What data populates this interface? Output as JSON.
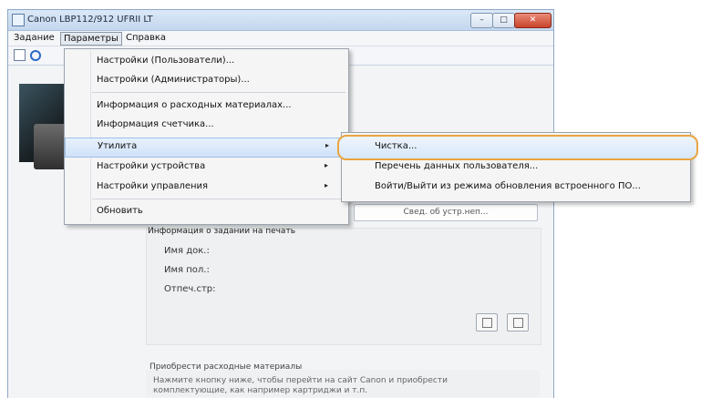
{
  "window": {
    "title": "Canon LBP112/912 UFRII LT",
    "minimize_glyph": "–",
    "maximize_glyph": "□",
    "close_glyph": "✕"
  },
  "menubar": {
    "task": "Задание",
    "params": "Параметры",
    "help": "Справка"
  },
  "dropdown": {
    "items": [
      {
        "label": "Настройки (Пользователи)..."
      },
      {
        "label": "Настройки (Администраторы)..."
      },
      {
        "label": "Информация о расходных материалах..."
      },
      {
        "label": "Информация счетчика..."
      },
      {
        "label": "Утилита",
        "arrow": "▸"
      },
      {
        "label": "Настройки устройства",
        "arrow": "▸"
      },
      {
        "label": "Настройки управления",
        "arrow": "▸"
      },
      {
        "label": "Обновить"
      }
    ]
  },
  "submenu": {
    "items": [
      {
        "label": "Чистка..."
      },
      {
        "label": "Перечень данных пользователя..."
      },
      {
        "label": "Войти/Выйти из режима обновления встроенного ПО..."
      }
    ]
  },
  "panel": {
    "device_info_button": "Свед. об устр.неп...",
    "job_info_title": "Информация о задании на печать",
    "doc_name": "Имя док.:",
    "user_name": "Имя пол.:",
    "printed_pages": "Отпеч.стр:"
  },
  "buy": {
    "title": "Приобрести расходные материалы",
    "text": "Нажмите кнопку ниже, чтобы перейти на сайт Canon и приобрести комплектующие, как например картриджи и т.п."
  },
  "icons": {
    "app": "app-icon",
    "list": "list-icon",
    "refresh": "refresh-icon"
  },
  "colors": {
    "highlight_border": "#e9a441",
    "close_button": "#c9432a"
  }
}
